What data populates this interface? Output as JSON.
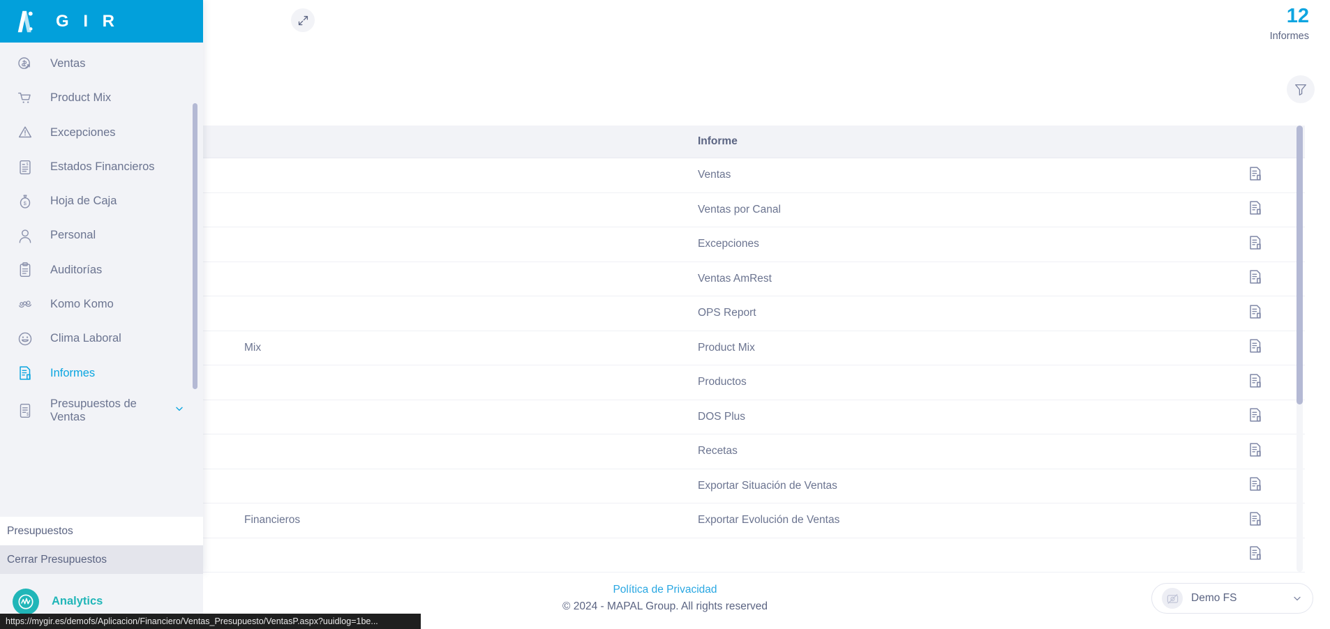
{
  "header": {
    "title_visible": "tics",
    "title_full": "Analytics",
    "expand_icon": "expand-arrows-icon",
    "count": "12",
    "count_label": "Informes",
    "filter_icon": "funnel-filter-icon"
  },
  "table": {
    "columns": {
      "aplicacion": "",
      "informe": "Informe",
      "action": ""
    },
    "rows": [
      {
        "aplicacion": "",
        "informe": "Ventas",
        "icon": "report-document-icon"
      },
      {
        "aplicacion": "",
        "informe": "Ventas por Canal",
        "icon": "report-document-icon"
      },
      {
        "aplicacion": "",
        "informe": "Excepciones",
        "icon": "report-document-icon"
      },
      {
        "aplicacion": "",
        "informe": "Ventas AmRest",
        "icon": "report-document-icon"
      },
      {
        "aplicacion": "",
        "informe": "OPS Report",
        "icon": "report-document-icon"
      },
      {
        "aplicacion": "Mix",
        "informe": "Product Mix",
        "icon": "report-document-icon"
      },
      {
        "aplicacion": "",
        "informe": "Productos",
        "icon": "report-document-icon"
      },
      {
        "aplicacion": "",
        "informe": "DOS Plus",
        "icon": "report-document-icon"
      },
      {
        "aplicacion": "",
        "informe": "Recetas",
        "icon": "report-document-icon"
      },
      {
        "aplicacion": "",
        "informe": "Exportar Situación de Ventas",
        "icon": "report-document-icon"
      },
      {
        "aplicacion": "Financieros",
        "informe": "Exportar Evolución de Ventas",
        "icon": "report-document-icon"
      },
      {
        "aplicacion": "",
        "informe": "",
        "icon": "report-document-icon"
      }
    ]
  },
  "sidebar": {
    "brand": "G I R",
    "logo_icon": "gir-logo-icon",
    "items": [
      {
        "label": "Ventas",
        "icon": "sales-dollar-icon",
        "active": false,
        "expandable": false
      },
      {
        "label": "Product Mix",
        "icon": "shopping-cart-icon",
        "active": false,
        "expandable": false
      },
      {
        "label": "Excepciones",
        "icon": "warning-triangle-icon",
        "active": false,
        "expandable": false
      },
      {
        "label": "Estados Financieros",
        "icon": "financial-statement-icon",
        "active": false,
        "expandable": false
      },
      {
        "label": "Hoja de Caja",
        "icon": "money-bag-icon",
        "active": false,
        "expandable": false
      },
      {
        "label": "Personal",
        "icon": "user-person-icon",
        "active": false,
        "expandable": false
      },
      {
        "label": "Auditorías",
        "icon": "clipboard-audit-icon",
        "active": false,
        "expandable": false
      },
      {
        "label": "Komo Komo",
        "icon": "komo-komo-icon",
        "active": false,
        "expandable": false
      },
      {
        "label": "Clima Laboral",
        "icon": "smiley-face-icon",
        "active": false,
        "expandable": false
      },
      {
        "label": "Informes",
        "icon": "reports-document-icon",
        "active": true,
        "expandable": false
      },
      {
        "label": "Presupuestos de Ventas",
        "icon": "budget-document-icon",
        "active": false,
        "expandable": true,
        "chevron_icon": "chevron-down-icon"
      }
    ],
    "submenu": [
      {
        "label": "Presupuestos",
        "highlight": false
      },
      {
        "label": "Cerrar Presupuestos",
        "highlight": true
      }
    ],
    "analytics": {
      "label": "Analytics",
      "icon": "analytics-wave-icon"
    }
  },
  "footer": {
    "privacy_link": "Política de Privacidad",
    "copyright": "© 2024 - MAPAL Group. All rights reserved",
    "company": {
      "name": "Demo FS",
      "avatar_icon": "company-placeholder-icon",
      "chevron_icon": "chevron-down-icon"
    }
  },
  "status_bar": {
    "url": "https://mygir.es/demofs/Aplicacion/Financiero/Ventas_Presupuesto/VentasP.aspx?uuidlog=1be..."
  },
  "colors": {
    "brand_blue": "#02a0db",
    "accent_blue": "#0aa5e0",
    "link_blue": "#29a7e2",
    "text": "#5b6482",
    "muted_text": "#6b7490",
    "sidebar_bg": "#f2f3f7",
    "analytics_teal": "#21b6b8",
    "scrollbar": "#b4b9d4"
  }
}
